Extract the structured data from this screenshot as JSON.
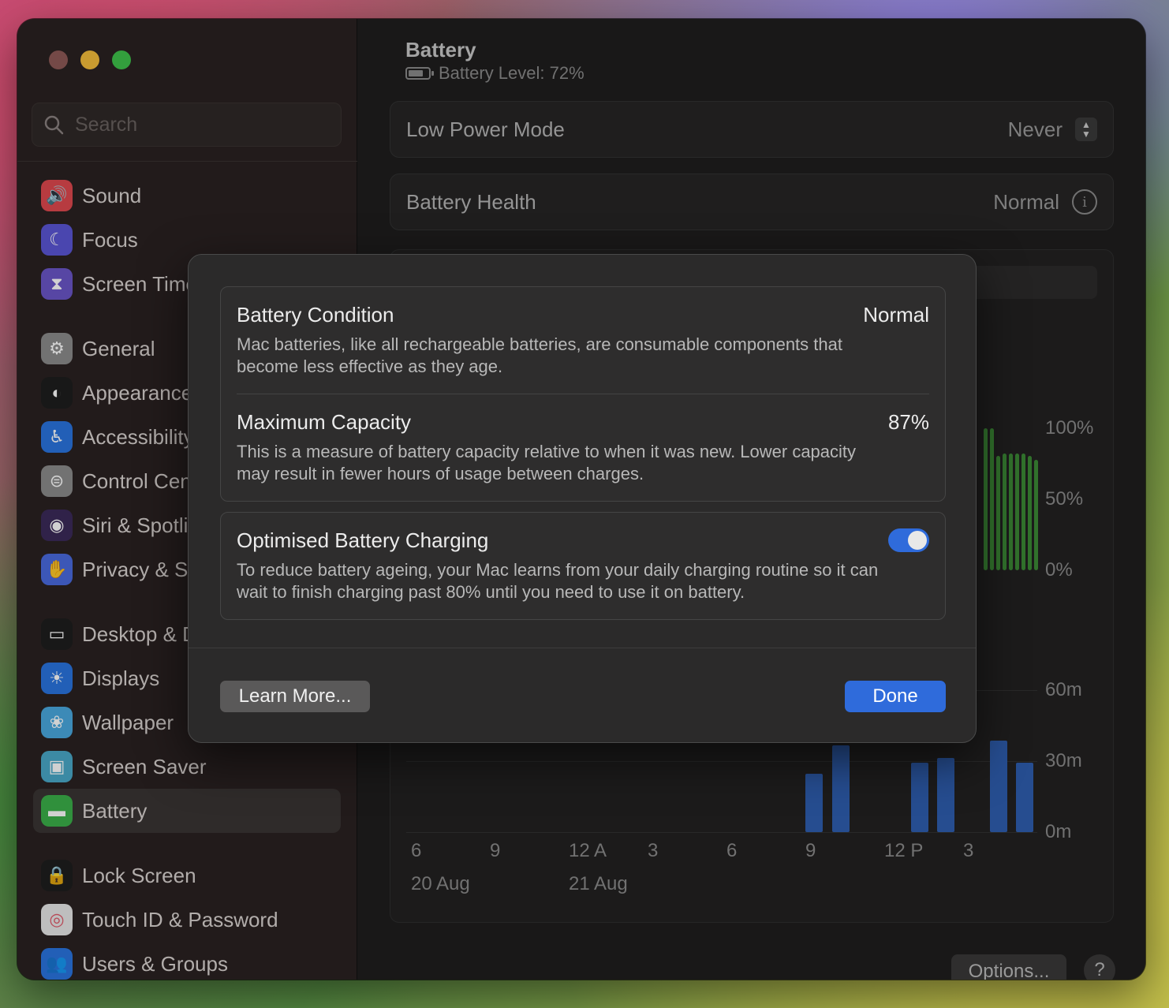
{
  "window": {
    "title": "Battery",
    "battery_level": "Battery Level: 72%"
  },
  "sidebar": {
    "search_placeholder": "Search",
    "items": [
      {
        "label": "Sound",
        "icon": "speaker-icon",
        "color": "#e0484f"
      },
      {
        "label": "Focus",
        "icon": "moon-icon",
        "color": "#5b56d6"
      },
      {
        "label": "Screen Time",
        "icon": "hourglass-icon",
        "color": "#6b56c9"
      },
      {
        "label": "General",
        "icon": "gear-icon",
        "color": "#8b8b8b"
      },
      {
        "label": "Appearance",
        "icon": "appearance-icon",
        "color": "#1e1e1e"
      },
      {
        "label": "Accessibility",
        "icon": "accessibility-icon",
        "color": "#2a74e0"
      },
      {
        "label": "Control Centre",
        "icon": "toggles-icon",
        "color": "#8b8b8b"
      },
      {
        "label": "Siri & Spotlight",
        "icon": "siri-icon",
        "color": "#3b2a5a"
      },
      {
        "label": "Privacy & Security",
        "icon": "hand-icon",
        "color": "#4a6be0"
      },
      {
        "label": "Desktop & Dock",
        "icon": "dock-icon",
        "color": "#1e1e1e"
      },
      {
        "label": "Displays",
        "icon": "sun-icon",
        "color": "#2a74e0"
      },
      {
        "label": "Wallpaper",
        "icon": "flower-icon",
        "color": "#4aa9e0"
      },
      {
        "label": "Screen Saver",
        "icon": "screensaver-icon",
        "color": "#4aa9c9"
      },
      {
        "label": "Battery",
        "icon": "battery-icon",
        "color": "#3bb04a"
      },
      {
        "label": "Lock Screen",
        "icon": "lock-icon",
        "color": "#1e1e1e"
      },
      {
        "label": "Touch ID & Password",
        "icon": "fingerprint-icon",
        "color": "#e8e8e8"
      },
      {
        "label": "Users & Groups",
        "icon": "users-icon",
        "color": "#2a74e0"
      }
    ]
  },
  "main": {
    "low_power_label": "Low Power Mode",
    "low_power_value": "Never",
    "health_label": "Battery Health",
    "health_value": "Normal",
    "level_axis": [
      "100%",
      "50%",
      "0%"
    ],
    "usage_axis": [
      "60m",
      "30m",
      "0m"
    ],
    "x_ticks": [
      "6",
      "9",
      "12 A",
      "3",
      "6",
      "9",
      "12 P",
      "3"
    ],
    "dates": [
      "20 Aug",
      "21 Aug"
    ],
    "options_label": "Options...",
    "help_label": "?"
  },
  "dialog": {
    "condition_title": "Battery Condition",
    "condition_value": "Normal",
    "condition_desc": "Mac batteries, like all rechargeable batteries, are consumable components that become less effective as they age.",
    "capacity_title": "Maximum Capacity",
    "capacity_value": "87%",
    "capacity_desc": "This is a measure of battery capacity relative to when it was new. Lower capacity may result in fewer hours of usage between charges.",
    "optimised_title": "Optimised Battery Charging",
    "optimised_desc": "To reduce battery ageing, your Mac learns from your daily charging routine so it can wait to finish charging past 80% until you need to use it on battery.",
    "optimised_enabled": true,
    "learn_more": "Learn More...",
    "done": "Done"
  },
  "colors": {
    "accent": "#2f6bdb",
    "battery_green": "#3c8a36",
    "usage_blue": "#2f5fb0"
  }
}
